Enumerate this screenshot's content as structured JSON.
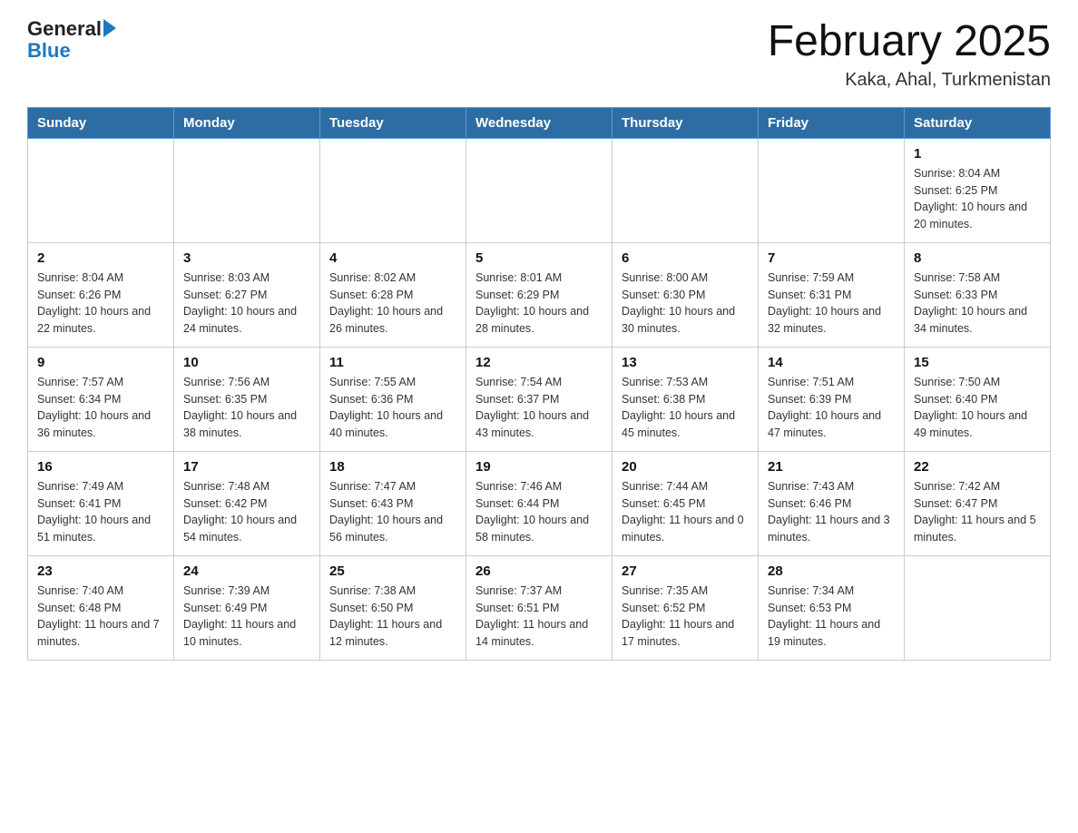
{
  "header": {
    "logo_general": "General",
    "logo_blue": "Blue",
    "month_title": "February 2025",
    "location": "Kaka, Ahal, Turkmenistan"
  },
  "weekdays": [
    "Sunday",
    "Monday",
    "Tuesday",
    "Wednesday",
    "Thursday",
    "Friday",
    "Saturday"
  ],
  "weeks": [
    [
      {
        "day": "",
        "sunrise": "",
        "sunset": "",
        "daylight": ""
      },
      {
        "day": "",
        "sunrise": "",
        "sunset": "",
        "daylight": ""
      },
      {
        "day": "",
        "sunrise": "",
        "sunset": "",
        "daylight": ""
      },
      {
        "day": "",
        "sunrise": "",
        "sunset": "",
        "daylight": ""
      },
      {
        "day": "",
        "sunrise": "",
        "sunset": "",
        "daylight": ""
      },
      {
        "day": "",
        "sunrise": "",
        "sunset": "",
        "daylight": ""
      },
      {
        "day": "1",
        "sunrise": "Sunrise: 8:04 AM",
        "sunset": "Sunset: 6:25 PM",
        "daylight": "Daylight: 10 hours and 20 minutes."
      }
    ],
    [
      {
        "day": "2",
        "sunrise": "Sunrise: 8:04 AM",
        "sunset": "Sunset: 6:26 PM",
        "daylight": "Daylight: 10 hours and 22 minutes."
      },
      {
        "day": "3",
        "sunrise": "Sunrise: 8:03 AM",
        "sunset": "Sunset: 6:27 PM",
        "daylight": "Daylight: 10 hours and 24 minutes."
      },
      {
        "day": "4",
        "sunrise": "Sunrise: 8:02 AM",
        "sunset": "Sunset: 6:28 PM",
        "daylight": "Daylight: 10 hours and 26 minutes."
      },
      {
        "day": "5",
        "sunrise": "Sunrise: 8:01 AM",
        "sunset": "Sunset: 6:29 PM",
        "daylight": "Daylight: 10 hours and 28 minutes."
      },
      {
        "day": "6",
        "sunrise": "Sunrise: 8:00 AM",
        "sunset": "Sunset: 6:30 PM",
        "daylight": "Daylight: 10 hours and 30 minutes."
      },
      {
        "day": "7",
        "sunrise": "Sunrise: 7:59 AM",
        "sunset": "Sunset: 6:31 PM",
        "daylight": "Daylight: 10 hours and 32 minutes."
      },
      {
        "day": "8",
        "sunrise": "Sunrise: 7:58 AM",
        "sunset": "Sunset: 6:33 PM",
        "daylight": "Daylight: 10 hours and 34 minutes."
      }
    ],
    [
      {
        "day": "9",
        "sunrise": "Sunrise: 7:57 AM",
        "sunset": "Sunset: 6:34 PM",
        "daylight": "Daylight: 10 hours and 36 minutes."
      },
      {
        "day": "10",
        "sunrise": "Sunrise: 7:56 AM",
        "sunset": "Sunset: 6:35 PM",
        "daylight": "Daylight: 10 hours and 38 minutes."
      },
      {
        "day": "11",
        "sunrise": "Sunrise: 7:55 AM",
        "sunset": "Sunset: 6:36 PM",
        "daylight": "Daylight: 10 hours and 40 minutes."
      },
      {
        "day": "12",
        "sunrise": "Sunrise: 7:54 AM",
        "sunset": "Sunset: 6:37 PM",
        "daylight": "Daylight: 10 hours and 43 minutes."
      },
      {
        "day": "13",
        "sunrise": "Sunrise: 7:53 AM",
        "sunset": "Sunset: 6:38 PM",
        "daylight": "Daylight: 10 hours and 45 minutes."
      },
      {
        "day": "14",
        "sunrise": "Sunrise: 7:51 AM",
        "sunset": "Sunset: 6:39 PM",
        "daylight": "Daylight: 10 hours and 47 minutes."
      },
      {
        "day": "15",
        "sunrise": "Sunrise: 7:50 AM",
        "sunset": "Sunset: 6:40 PM",
        "daylight": "Daylight: 10 hours and 49 minutes."
      }
    ],
    [
      {
        "day": "16",
        "sunrise": "Sunrise: 7:49 AM",
        "sunset": "Sunset: 6:41 PM",
        "daylight": "Daylight: 10 hours and 51 minutes."
      },
      {
        "day": "17",
        "sunrise": "Sunrise: 7:48 AM",
        "sunset": "Sunset: 6:42 PM",
        "daylight": "Daylight: 10 hours and 54 minutes."
      },
      {
        "day": "18",
        "sunrise": "Sunrise: 7:47 AM",
        "sunset": "Sunset: 6:43 PM",
        "daylight": "Daylight: 10 hours and 56 minutes."
      },
      {
        "day": "19",
        "sunrise": "Sunrise: 7:46 AM",
        "sunset": "Sunset: 6:44 PM",
        "daylight": "Daylight: 10 hours and 58 minutes."
      },
      {
        "day": "20",
        "sunrise": "Sunrise: 7:44 AM",
        "sunset": "Sunset: 6:45 PM",
        "daylight": "Daylight: 11 hours and 0 minutes."
      },
      {
        "day": "21",
        "sunrise": "Sunrise: 7:43 AM",
        "sunset": "Sunset: 6:46 PM",
        "daylight": "Daylight: 11 hours and 3 minutes."
      },
      {
        "day": "22",
        "sunrise": "Sunrise: 7:42 AM",
        "sunset": "Sunset: 6:47 PM",
        "daylight": "Daylight: 11 hours and 5 minutes."
      }
    ],
    [
      {
        "day": "23",
        "sunrise": "Sunrise: 7:40 AM",
        "sunset": "Sunset: 6:48 PM",
        "daylight": "Daylight: 11 hours and 7 minutes."
      },
      {
        "day": "24",
        "sunrise": "Sunrise: 7:39 AM",
        "sunset": "Sunset: 6:49 PM",
        "daylight": "Daylight: 11 hours and 10 minutes."
      },
      {
        "day": "25",
        "sunrise": "Sunrise: 7:38 AM",
        "sunset": "Sunset: 6:50 PM",
        "daylight": "Daylight: 11 hours and 12 minutes."
      },
      {
        "day": "26",
        "sunrise": "Sunrise: 7:37 AM",
        "sunset": "Sunset: 6:51 PM",
        "daylight": "Daylight: 11 hours and 14 minutes."
      },
      {
        "day": "27",
        "sunrise": "Sunrise: 7:35 AM",
        "sunset": "Sunset: 6:52 PM",
        "daylight": "Daylight: 11 hours and 17 minutes."
      },
      {
        "day": "28",
        "sunrise": "Sunrise: 7:34 AM",
        "sunset": "Sunset: 6:53 PM",
        "daylight": "Daylight: 11 hours and 19 minutes."
      },
      {
        "day": "",
        "sunrise": "",
        "sunset": "",
        "daylight": ""
      }
    ]
  ]
}
